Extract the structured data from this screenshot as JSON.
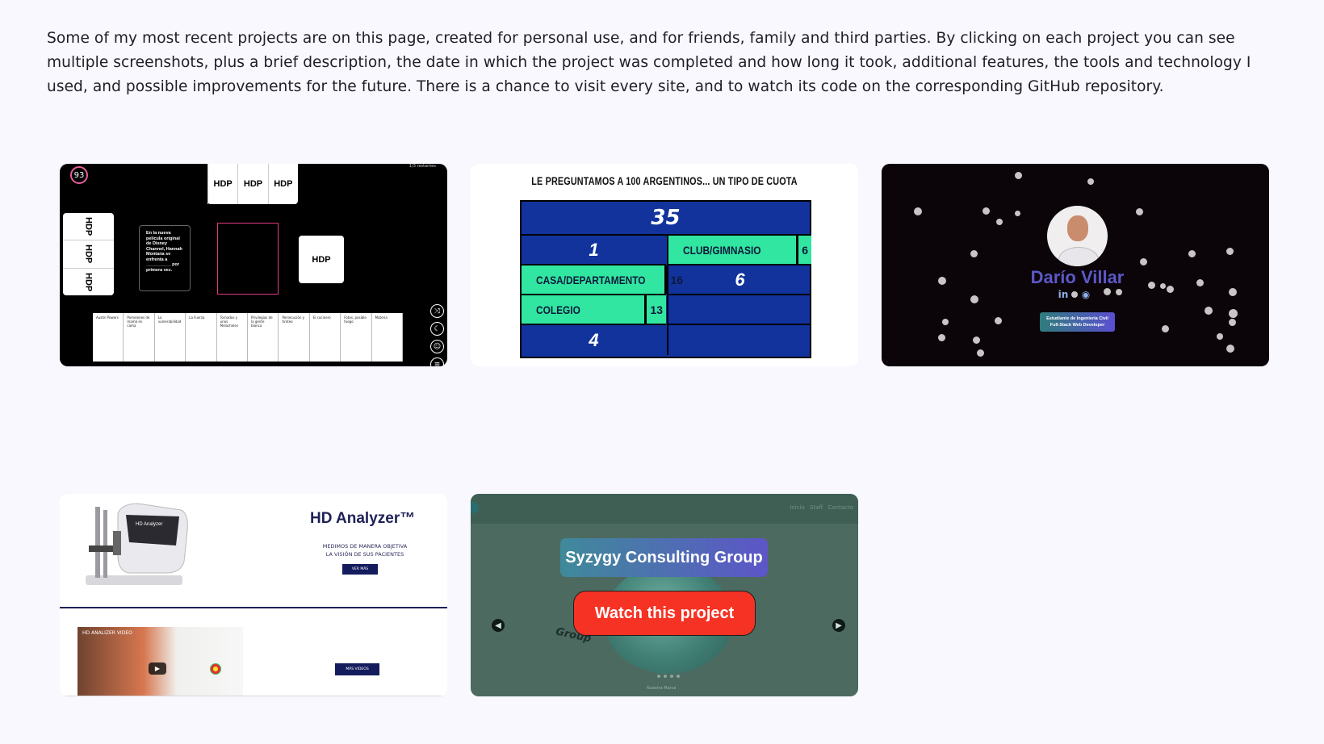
{
  "intro": "Some of my most recent projects are on this page, created for personal use, and for friends, family and third parties. By clicking on each project you can see multiple screenshots, plus a brief description, the date in which the project was completed and how long it took, additional features, the tools and technology I used, and possible improvements for the future. There is a chance to visit every site, and to watch its code on the corresponding GitHub repository.",
  "projects": [
    {
      "counter": "93",
      "top_right": "1/3 restantes",
      "top_cards": [
        "HDP",
        "HDP",
        "HDP"
      ],
      "left_cards": [
        "HDP",
        "HDP",
        "HDP"
      ],
      "black_card": "En la nueva película original de Disney Channel, Hannah Montana se enfrenta a __________ por primera vez.",
      "right_card": "HDP",
      "bottom_cards": [
        "Austin Powers",
        "Pomelones de mamá en cama",
        "La vulnerabilidad",
        "La Fuerza",
        "Tornados y unos Melacholes",
        "Privilegios de la gente blanca",
        "Persecución y tiroteo",
        "El cocinero",
        "Fotos, posible fuego",
        "Materia"
      ],
      "side_icons": [
        "shuffle-icon",
        "moon-icon",
        "robot-icon",
        "menu-icon"
      ]
    },
    {
      "question": "LE PREGUNTAMOS A 100 ARGENTINOS... UN TIPO DE CUOTA",
      "score": "35",
      "left_col": [
        {
          "type": "num",
          "text": "1"
        },
        {
          "type": "ans",
          "text": "CASA/DEPARTAMENTO",
          "pts": "16"
        },
        {
          "type": "ans",
          "text": "COLEGIO",
          "pts": "13"
        },
        {
          "type": "num",
          "text": "4"
        }
      ],
      "right_col": [
        {
          "type": "ans",
          "text": "CLUB/GIMNASIO",
          "pts": "6"
        },
        {
          "type": "num",
          "text": "6"
        },
        {
          "type": "empty",
          "text": ""
        },
        {
          "type": "empty",
          "text": ""
        }
      ]
    },
    {
      "name": "Darío Villar",
      "badge_line1": "Estudiante de Ingeniería Civil",
      "badge_line2": "Full-Stack Web Developer",
      "socials": [
        "linkedin-icon",
        "github-icon"
      ]
    },
    {
      "title": "HD Analyzer™",
      "subtitle_line1": "MEDIMOS DE MANERA OBJETIVA",
      "subtitle_line2": "LA VISIÓN DE SUS PACIENTES",
      "button1": "VER MÁS",
      "video_title": "HD ANALIZER VIDEO",
      "button2": "MÁS VIDEOS"
    },
    {
      "nav": "Inicio Staff Contacto",
      "label": "Syzygy Consulting Group",
      "watch": "Watch this project",
      "sphere_text": "Group",
      "caption": "Nuestra Marca"
    }
  ]
}
